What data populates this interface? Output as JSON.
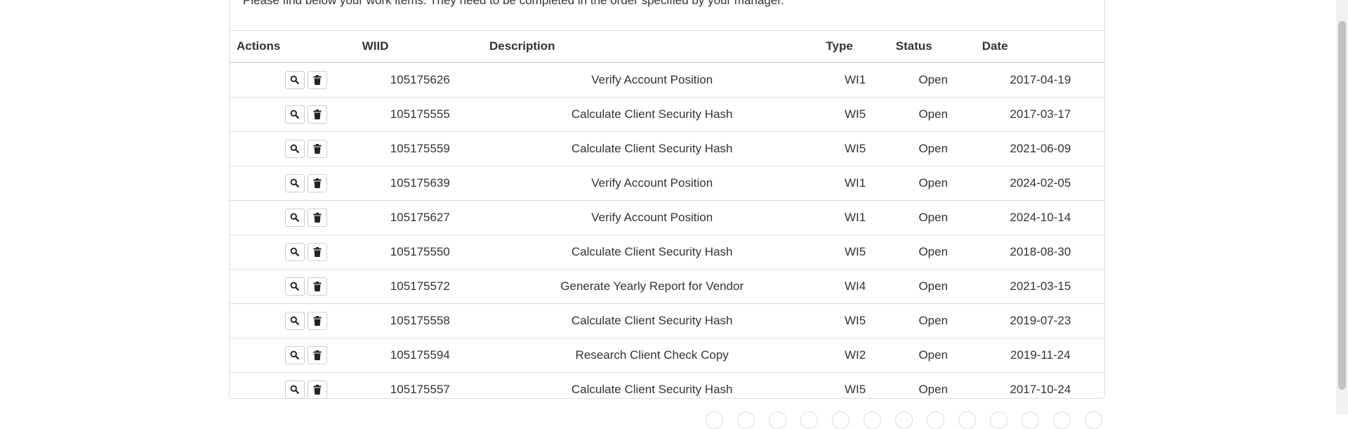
{
  "intro_text": "Please find below your work items. They need to be completed in the order specified by your manager.",
  "table": {
    "headers": {
      "actions": "Actions",
      "wiid": "WIID",
      "description": "Description",
      "type": "Type",
      "status": "Status",
      "date": "Date"
    },
    "rows": [
      {
        "wiid": "105175626",
        "description": "Verify Account Position",
        "type": "WI1",
        "status": "Open",
        "date": "2017-04-19"
      },
      {
        "wiid": "105175555",
        "description": "Calculate Client Security Hash",
        "type": "WI5",
        "status": "Open",
        "date": "2017-03-17"
      },
      {
        "wiid": "105175559",
        "description": "Calculate Client Security Hash",
        "type": "WI5",
        "status": "Open",
        "date": "2021-06-09"
      },
      {
        "wiid": "105175639",
        "description": "Verify Account Position",
        "type": "WI1",
        "status": "Open",
        "date": "2024-02-05"
      },
      {
        "wiid": "105175627",
        "description": "Verify Account Position",
        "type": "WI1",
        "status": "Open",
        "date": "2024-10-14"
      },
      {
        "wiid": "105175550",
        "description": "Calculate Client Security Hash",
        "type": "WI5",
        "status": "Open",
        "date": "2018-08-30"
      },
      {
        "wiid": "105175572",
        "description": "Generate Yearly Report for Vendor",
        "type": "WI4",
        "status": "Open",
        "date": "2021-03-15"
      },
      {
        "wiid": "105175558",
        "description": "Calculate Client Security Hash",
        "type": "WI5",
        "status": "Open",
        "date": "2019-07-23"
      },
      {
        "wiid": "105175594",
        "description": "Research Client Check Copy",
        "type": "WI2",
        "status": "Open",
        "date": "2019-11-24"
      },
      {
        "wiid": "105175557",
        "description": "Calculate Client Security Hash",
        "type": "WI5",
        "status": "Open",
        "date": "2017-10-24"
      }
    ]
  },
  "icons": {
    "view": "search-icon",
    "delete": "trash-icon"
  }
}
